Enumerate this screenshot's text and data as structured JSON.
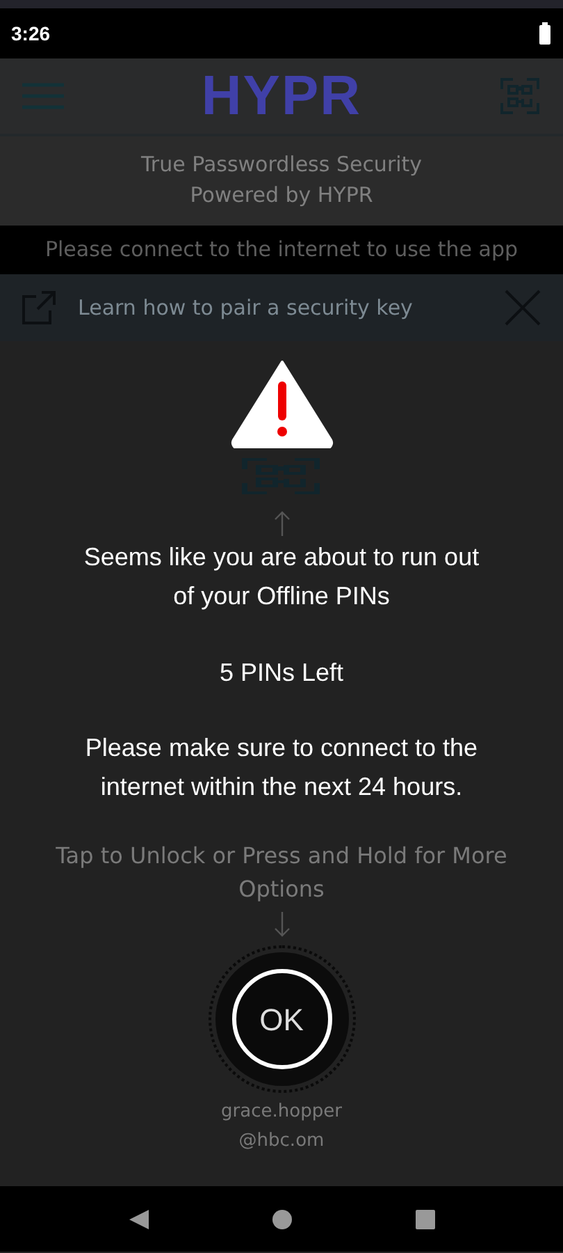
{
  "status_bar": {
    "time": "3:26"
  },
  "header": {
    "logo": "HYPR"
  },
  "tagline": [
    "True Passwordless Security",
    "Powered by HYPR"
  ],
  "offline_banner": "Please connect to the internet to use the app",
  "pair_banner": {
    "text": "Learn how to pair a security key"
  },
  "main": {
    "hint": "Tap to Unlock or Press and Hold for More Options",
    "user": [
      "grace.hopper",
      "@hbc.om"
    ]
  },
  "dialog": {
    "message": "Seems like you are about to run out of your Offline PINs",
    "count": "5 PINs Left",
    "instruction": "Please make sure to connect to the internet within the next 24 hours.",
    "button": "OK"
  }
}
